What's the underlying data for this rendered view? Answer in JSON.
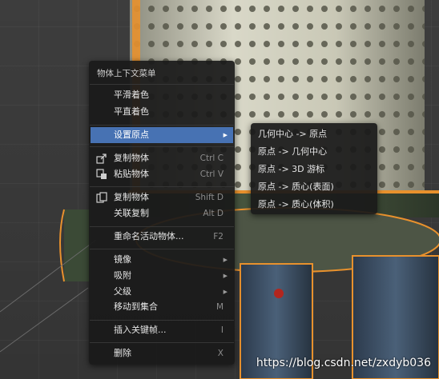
{
  "context_menu": {
    "title": "物体上下文菜单",
    "items": {
      "smooth": {
        "label": "平滑着色"
      },
      "flat": {
        "label": "平直着色"
      },
      "set_origin": {
        "label": "设置原点"
      },
      "copy": {
        "label": "复制物体",
        "shortcut": "Ctrl C",
        "icon": "copy-icon"
      },
      "paste": {
        "label": "粘贴物体",
        "shortcut": "Ctrl V",
        "icon": "paste-icon"
      },
      "duplicate": {
        "label": "复制物体",
        "shortcut": "Shift D",
        "icon": "duplicate-icon"
      },
      "linked": {
        "label": "关联复制",
        "shortcut": "Alt D"
      },
      "rename": {
        "label": "重命名活动物体...",
        "shortcut": "F2"
      },
      "mirror": {
        "label": "镜像"
      },
      "snap": {
        "label": "吸附"
      },
      "parent": {
        "label": "父级"
      },
      "move_collection": {
        "label": "移动到集合",
        "shortcut": "M"
      },
      "insert_keyframe": {
        "label": "插入关键帧...",
        "shortcut": "I"
      },
      "delete": {
        "label": "删除",
        "shortcut": "X"
      }
    }
  },
  "origin_submenu": {
    "items": [
      "几何中心 -> 原点",
      "原点 -> 几何中心",
      "原点 -> 3D 游标",
      "原点 -> 质心(表面)",
      "原点 -> 质心(体积)"
    ]
  },
  "watermark": "https://blog.csdn.net/zxdyb036",
  "colors": {
    "highlight": "#4772b3",
    "menu_bg": "#1a1a1a",
    "selection_outline": "#e8912d"
  }
}
